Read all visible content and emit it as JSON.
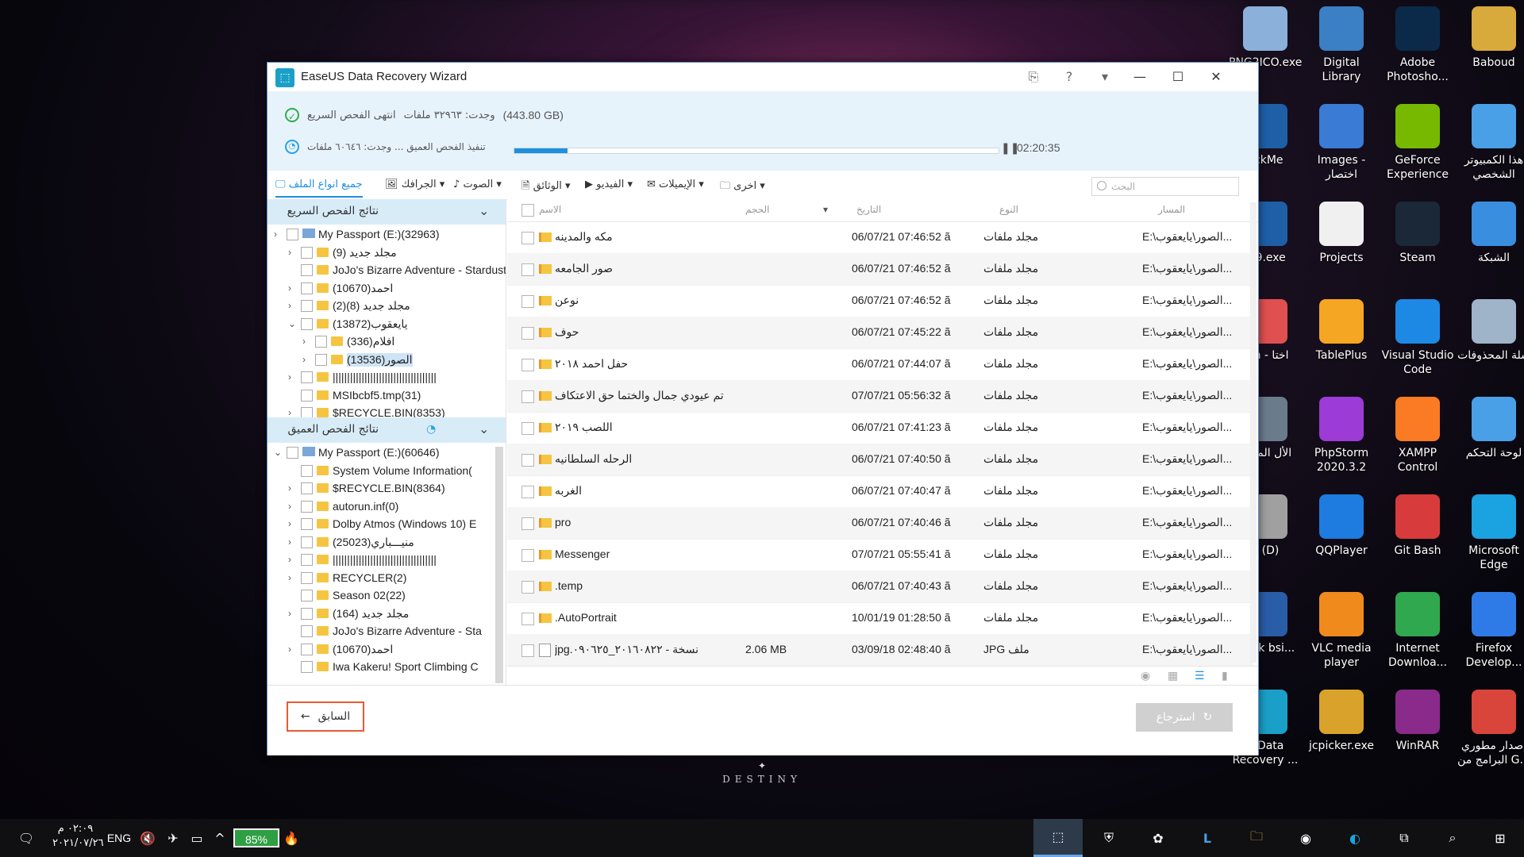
{
  "desktop": {
    "icons": [
      {
        "label": "PNG2ICO.exe",
        "color": "#8bb0d9"
      },
      {
        "label": "Digital Library",
        "color": "#3b7fc4"
      },
      {
        "label": "Adobe Photosho...",
        "color": "#0b2a4a"
      },
      {
        "label": "Baboud",
        "color": "#d8a93b"
      },
      {
        "label": "ackMe",
        "color": "#1e5fa8"
      },
      {
        "label": "Images - اختصار",
        "color": "#3a7bd5"
      },
      {
        "label": "GeForce Experience",
        "color": "#76b900"
      },
      {
        "label": "هذا الكمبيوتر الشخصي",
        "color": "#4aa0e6"
      },
      {
        "label": "3.9.exe",
        "color": "#1e5fa8"
      },
      {
        "label": "Projects",
        "color": "#f0f0f0"
      },
      {
        "label": "Steam",
        "color": "#1b2838"
      },
      {
        "label": "الشبكة",
        "color": "#3a8ee0"
      },
      {
        "label": "lish - اختا",
        "color": "#e05050"
      },
      {
        "label": "TablePlus",
        "color": "#f5a623"
      },
      {
        "label": "Visual Studio Code",
        "color": "#1e88e5"
      },
      {
        "label": "سلة المحذوفات",
        "color": "#9fb4c8"
      },
      {
        "label": "الأل المحف",
        "color": "#6a7b8c"
      },
      {
        "label": "PhpStorm 2020.3.2 x64",
        "color": "#9c3bd6"
      },
      {
        "label": "XAMPP Control Panel",
        "color": "#fb7a24"
      },
      {
        "label": "لوحة التحكم",
        "color": "#4aa0e6"
      },
      {
        "label": "a (D)",
        "color": "#a0a0a0"
      },
      {
        "label": "QQPlayer",
        "color": "#1e7be0"
      },
      {
        "label": "Git Bash",
        "color": "#d83b3b"
      },
      {
        "label": "Microsoft Edge",
        "color": "#1aa3e0"
      },
      {
        "label": "Track bsi...",
        "color": "#2a5da8"
      },
      {
        "label": "VLC media player",
        "color": "#f08a1c"
      },
      {
        "label": "Internet Downloa...",
        "color": "#2fa84f"
      },
      {
        "label": "Firefox Develop...",
        "color": "#2e7be8"
      },
      {
        "label": "S Data Recovery ...",
        "color": "#1aa0c8"
      },
      {
        "label": "jcpicker.exe",
        "color": "#d9a22b"
      },
      {
        "label": "WinRAR",
        "color": "#8a2a8a"
      },
      {
        "label": "إصدار مطوري البرامج من G...",
        "color": "#d9453b"
      }
    ],
    "wallpaper_text": "DESTINY"
  },
  "window": {
    "title": "EaseUS Data Recovery Wizard",
    "quick_scan": {
      "status": "انتهى الفحص السريع",
      "found": "وجدت: ٣٢٩٦٣ ملفات",
      "size": "(443.80 GB)"
    },
    "deep_scan": {
      "status": "تنفيذ الفحص العميق ... وجدت: ٦٠٦٤٦ ملفات",
      "progress": 0.11,
      "elapsed": "02:20:35"
    },
    "filter_tabs": [
      {
        "label": "جميع انواع الملف",
        "active": true
      },
      {
        "label": "الجرافك"
      },
      {
        "label": "الصوت"
      },
      {
        "label": "الوثائق"
      },
      {
        "label": "الفيديو"
      },
      {
        "label": "الإيميلات"
      },
      {
        "label": "اخرى"
      }
    ],
    "search_placeholder": "البحث",
    "quick_section_title": "نتائج الفحص السريع",
    "deep_section_title": "نتائج الفحص العميق",
    "quick_tree": [
      {
        "label": "My Passport (E:)(32963)",
        "level": 0,
        "type": "drive"
      },
      {
        "label": "مجلد جديد (9)",
        "level": 1,
        "arrow": true
      },
      {
        "label": "JoJo's Bizarre Adventure - Stardust",
        "level": 1
      },
      {
        "label": "احمد(10670)",
        "level": 1,
        "arrow": true
      },
      {
        "label": "مجلد جديد (8)(2)",
        "level": 1,
        "arrow": true
      },
      {
        "label": "يايعقوب(13872)",
        "level": 1,
        "arrow": true,
        "open": true
      },
      {
        "label": "افلام(336)",
        "level": 2,
        "arrow": true
      },
      {
        "label": "الصور(13536)",
        "level": 2,
        "arrow": true,
        "selected": true
      },
      {
        "label": "||||||||||||||||||||||||||||||||||||",
        "level": 1,
        "arrow": true
      },
      {
        "label": "MSIbcbf5.tmp(31)",
        "level": 1
      },
      {
        "label": "$RECYCLE.BIN(8353)",
        "level": 1,
        "arrow": true
      }
    ],
    "deep_tree": [
      {
        "label": "My Passport (E:)(60646)",
        "level": 0,
        "type": "drive",
        "open": true
      },
      {
        "label": "System Volume Information(",
        "level": 1
      },
      {
        "label": "$RECYCLE.BIN(8364)",
        "level": 1,
        "arrow": true
      },
      {
        "label": "autorun.inf(0)",
        "level": 1,
        "arrow": true
      },
      {
        "label": "Dolby Atmos (Windows 10) E",
        "level": 1,
        "arrow": true
      },
      {
        "label": "منيـــباري(25023)",
        "level": 1,
        "arrow": true
      },
      {
        "label": "||||||||||||||||||||||||||||||||||||",
        "level": 1,
        "arrow": true
      },
      {
        "label": "RECYCLER(2)",
        "level": 1,
        "arrow": true
      },
      {
        "label": "Season 02(22)",
        "level": 1
      },
      {
        "label": "مجلد جديد (164)",
        "level": 1,
        "arrow": true
      },
      {
        "label": "JoJo's Bizarre Adventure - Sta",
        "level": 1
      },
      {
        "label": "احمد(10670)",
        "level": 1,
        "arrow": true
      },
      {
        "label": "Iwa Kakeru! Sport Climbing C",
        "level": 1
      }
    ],
    "table_headers": {
      "name": "الاسم",
      "size": "الحجم",
      "date": "التاريخ",
      "type": "النوع",
      "path": "المسار"
    },
    "rows": [
      {
        "name": "مكه والمدينه",
        "size": "",
        "date": "06/07/21 07:46:52 ã",
        "type": "مجلد ملفات",
        "path": "E:\\الصور\\يايعقوب...",
        "icon": "folder"
      },
      {
        "name": "صور الجامعه",
        "size": "",
        "date": "06/07/21 07:46:52 ã",
        "type": "مجلد ملفات",
        "path": "E:\\الصور\\يايعقوب...",
        "icon": "folder"
      },
      {
        "name": "نوعن",
        "size": "",
        "date": "06/07/21 07:46:52 ã",
        "type": "مجلد ملفات",
        "path": "E:\\الصور\\يايعقوب...",
        "icon": "folder"
      },
      {
        "name": "حوف",
        "size": "",
        "date": "06/07/21 07:45:22 ã",
        "type": "مجلد ملفات",
        "path": "E:\\الصور\\يايعقوب...",
        "icon": "folder"
      },
      {
        "name": "حفل احمد ٢٠١٨",
        "size": "",
        "date": "06/07/21 07:44:07 ã",
        "type": "مجلد ملفات",
        "path": "E:\\الصور\\يايعقوب...",
        "icon": "folder"
      },
      {
        "name": "تم عيودي جمال والختما حق الاعتكاف",
        "size": "",
        "date": "07/07/21 05:56:32 ã",
        "type": "مجلد ملفات",
        "path": "E:\\الصور\\يايعقوب...",
        "icon": "folder"
      },
      {
        "name": "اللصب ٢٠١٩",
        "size": "",
        "date": "06/07/21 07:41:23 ã",
        "type": "مجلد ملفات",
        "path": "E:\\الصور\\يايعقوب...",
        "icon": "folder"
      },
      {
        "name": "الرحله السلطانيه",
        "size": "",
        "date": "06/07/21 07:40:50 ã",
        "type": "مجلد ملفات",
        "path": "E:\\الصور\\يايعقوب...",
        "icon": "folder"
      },
      {
        "name": "الغربه",
        "size": "",
        "date": "06/07/21 07:40:47 ã",
        "type": "مجلد ملفات",
        "path": "E:\\الصور\\يايعقوب...",
        "icon": "folder"
      },
      {
        "name": "pro",
        "size": "",
        "date": "06/07/21 07:40:46 ã",
        "type": "مجلد ملفات",
        "path": "E:\\الصور\\يايعقوب...",
        "icon": "folder"
      },
      {
        "name": "Messenger",
        "size": "",
        "date": "07/07/21 05:55:41 ã",
        "type": "مجلد ملفات",
        "path": "E:\\الصور\\يايعقوب...",
        "icon": "folder"
      },
      {
        "name": ".temp",
        "size": "",
        "date": "06/07/21 07:40:43 ã",
        "type": "مجلد ملفات",
        "path": "E:\\الصور\\يايعقوب...",
        "icon": "folder"
      },
      {
        "name": ".AutoPortrait",
        "size": "",
        "date": "10/01/19 01:28:50 ã",
        "type": "مجلد ملفات",
        "path": "E:\\الصور\\يايعقوب...",
        "icon": "folder"
      },
      {
        "name": "jpg.نسخة - ٢٠١٦٠٨٢٢_٠٩٠٦٢٥",
        "size": "2.06 MB",
        "date": "03/09/18 02:48:40 ã",
        "type": "JPG ملف",
        "path": "E:\\الصور\\يايعقوب...",
        "icon": "jpg"
      }
    ],
    "back_label": "السابق",
    "recover_label": "استرجاع"
  },
  "taskbar": {
    "clock_time": "٠٢:٠٩ م",
    "clock_date": "٢٠٢١/٠٧/٢٦",
    "language": "ENG",
    "battery": "85%"
  }
}
